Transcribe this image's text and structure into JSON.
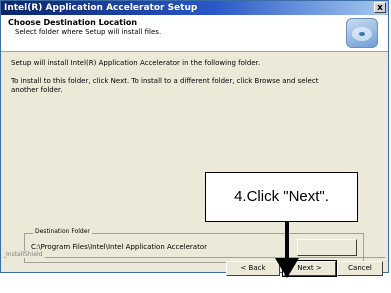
{
  "window": {
    "title": "Intel(R) Application Accelerator Setup",
    "close_glyph": "x"
  },
  "header": {
    "title": "Choose Destination Location",
    "subtitle": "Select folder where Setup will install files.",
    "logo_icon": "setup-install-icon"
  },
  "content": {
    "line1": "Setup will install Intel(R) Application Accelerator in the following folder.",
    "line2": "To install to this folder, click Next. To install to a different folder, click Browse and select another folder."
  },
  "destination": {
    "legend": "Destination Folder",
    "path": "C:\\Program Files\\Intel\\Intel Application Accelerator"
  },
  "footer": {
    "brand": "InstallShield",
    "back_label": "< Back",
    "next_label": "Next >",
    "cancel_label": "Cancel"
  },
  "callout": {
    "text": "4.Click  \"Next\"."
  },
  "colors": {
    "title_bar": "#0a246a",
    "dialog_bg": "#ece9d8"
  }
}
